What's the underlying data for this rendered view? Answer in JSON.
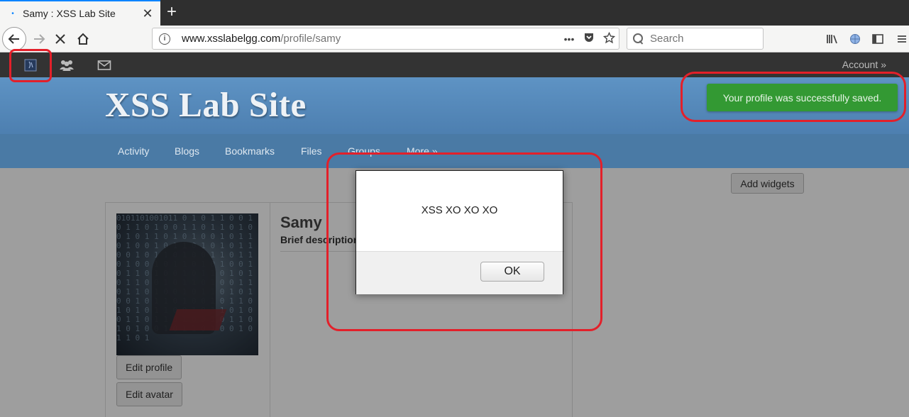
{
  "browser": {
    "tab_title": "Samy : XSS Lab Site",
    "tab_favicon": "•",
    "new_tab": "+",
    "close_tab": "✕",
    "url_domain": "www.xsslabelgg.com",
    "url_path": "/profile/samy",
    "search_placeholder": "Search",
    "page_actions": "•••"
  },
  "topbar": {
    "account_label": "Account »"
  },
  "header": {
    "site_title": "XSS Lab Site",
    "success_message": "Your profile was successfully saved."
  },
  "menu": {
    "items": [
      "Activity",
      "Blogs",
      "Bookmarks",
      "Files",
      "Groups",
      "More »"
    ]
  },
  "content": {
    "add_widgets": "Add widgets",
    "profile_name": "Samy",
    "brief_description": "Brief description:",
    "edit_profile": "Edit profile",
    "edit_avatar": "Edit avatar"
  },
  "dialog": {
    "message": "XSS XO XO XO",
    "ok_label": "OK"
  },
  "avatar_code": "0101101001011 0 1 0 1 1 0 0 1 0 1 1 0 1 0 0 1 1 0 1 1 0 1 0 0 1 0 1 1 0 1 0 1 0 0 1 0 1 1 0 1 0 0 1 0 1 1 0 1 0 1 0 1 1 0 0 1 0 1 1 0 1 0 0 1 1 0 1 1 0 1 0 0 1 0 1 1 0 1 0 1 0 0 1 0 1 1 0 1 0 0 1 0 1 1 0 1 0 1 0 1 1 0 0 1 0 1 1 0 1 0 0 1 1 0 1 1 0 1 0 0 1 0 1 1 0 1 0 1 0 0 1 0 1 1 0 1 0 0 1 0 1 1 0 1 0 1 0 1 1 0 0 1 0 1 1 0 1 0 0 1 1 0 1 1 0 1 0 0 1 0 1 1 0 1 0 1 0 0 1 0 1 1 0 1 0 0 1 0 1 1 0 1"
}
